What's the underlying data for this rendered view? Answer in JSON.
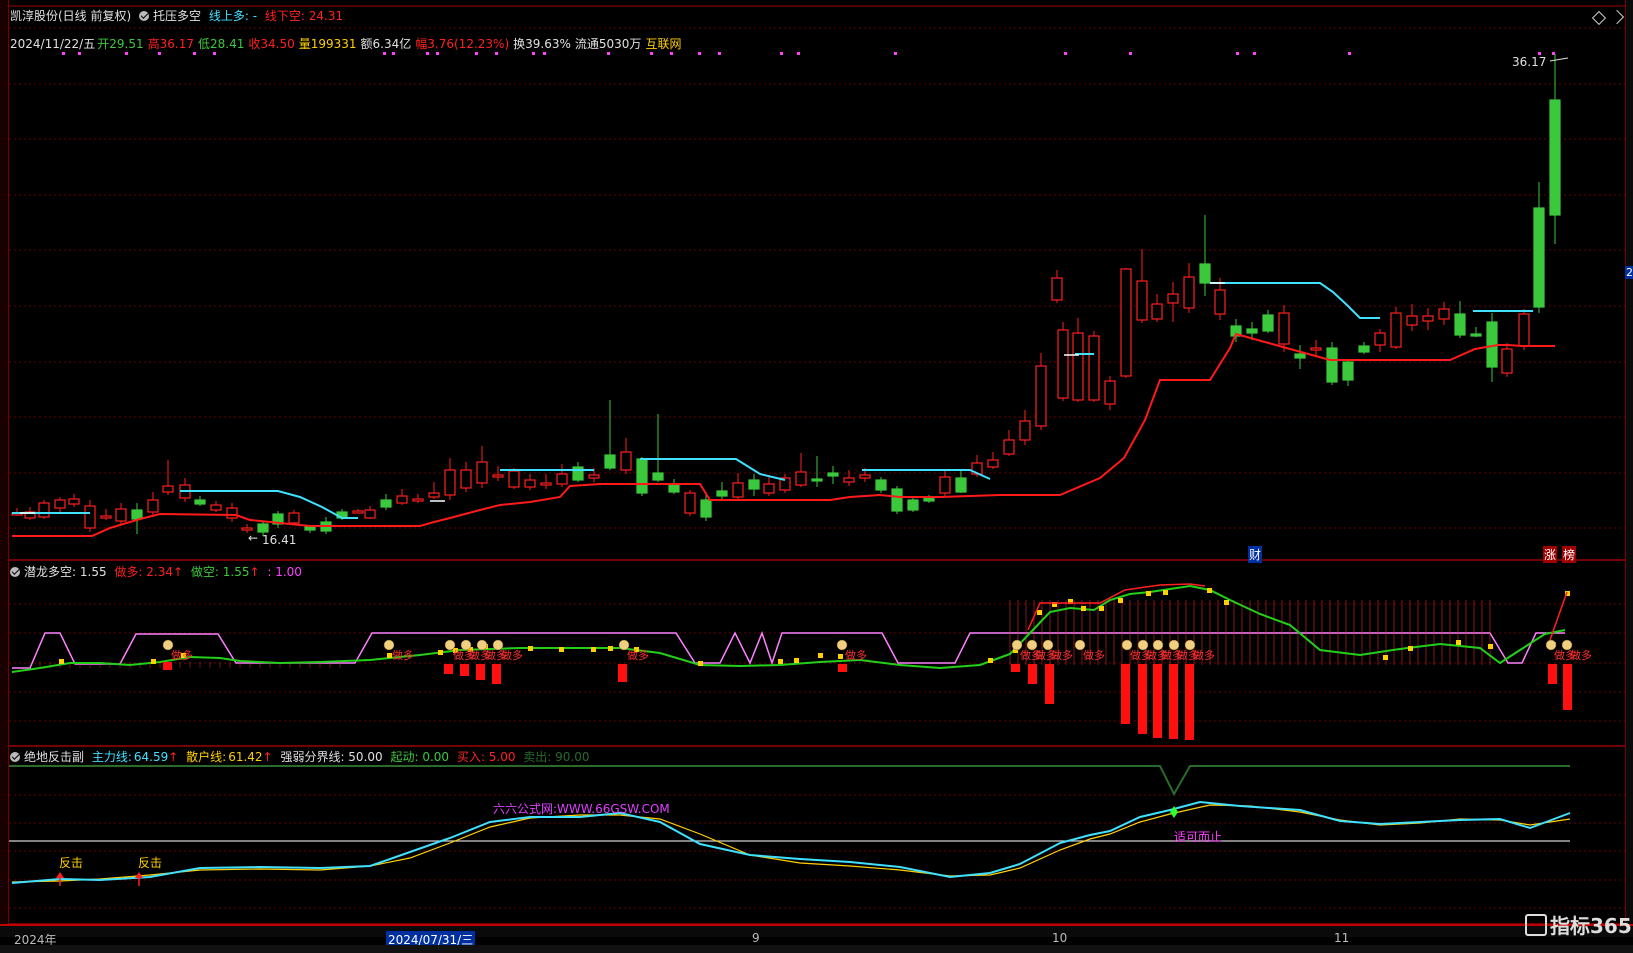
{
  "main_panel": {
    "stock_name": "凯淳股份(日线 前复权)",
    "indicator_name": "托压多空",
    "line_up_label": "线上多: -",
    "line_down_label": "线下空: 24.31",
    "date": "2024/11/22/五",
    "open_label": "开",
    "open": "29.51",
    "high_label": "高",
    "high": "36.17",
    "low_label": "低",
    "low": "28.41",
    "close_label": "收",
    "close": "34.50",
    "volume_label": "量",
    "volume": "199331",
    "amount": "额6.34亿",
    "amplitude": "幅3.76(12.23%)",
    "turnover": "换39.63%",
    "float_shares": "流通5030万",
    "tag": "互联网",
    "high_marker": "36.17",
    "low_marker": "16.41",
    "event_cai": "财",
    "event_zhang": "涨",
    "event_bang": "榜",
    "right_axis_mark": "2"
  },
  "panel2": {
    "indicator_name": "潜龙多空",
    "value": ": 1.55",
    "zuoduo_label": "做多: 2.34",
    "zuokong_label": "做空: 1.55",
    "third_label": ": 1.00",
    "signal_text": "做多"
  },
  "panel3": {
    "indicator_name": "绝地反击副",
    "main_line_label": "主力线:",
    "main_line_value": "64.59",
    "retail_line_label": "散户线:",
    "retail_line_value": "61.42",
    "divide_label": "强弱分界线: 50.00",
    "start_label": "起动: 0.00",
    "buy_label": "买入: 5.00",
    "sell_label": "卖出: 90.00",
    "watermark": "六六公式网:WWW.66GSW.COM",
    "fanji_1": "反击",
    "fanji_2": "反击",
    "stop_text": "适可而止"
  },
  "x_axis": {
    "year": "2024年",
    "cursor_date": "2024/07/31/三",
    "m9": "9",
    "m10": "10",
    "m11": "11"
  },
  "brand": "指标365",
  "colors": {
    "bg": "#000000",
    "up": "#ff2020",
    "down": "#3cc83c",
    "cyan": "#40e0ff",
    "magenta": "#ff40ff",
    "yellow": "#ffd000",
    "green_line": "#30d020",
    "grid": "#8a0000"
  }
}
